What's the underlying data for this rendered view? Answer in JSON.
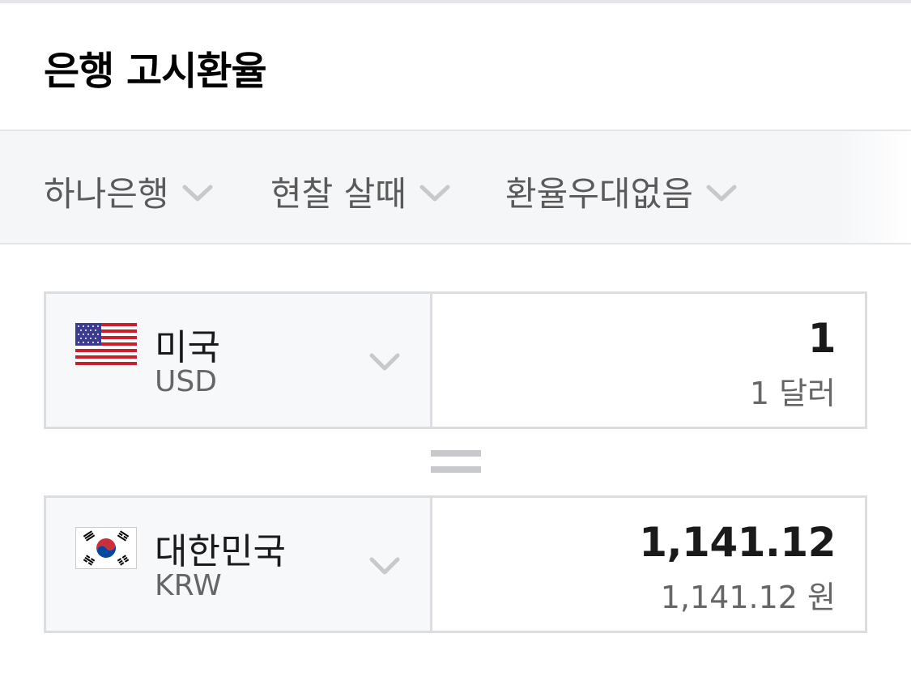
{
  "header": {
    "title": "은행 고시환율"
  },
  "filters": [
    {
      "label": "하나은행",
      "icon": "chevron-down-icon"
    },
    {
      "label": "현찰 살때",
      "icon": "chevron-down-icon"
    },
    {
      "label": "환율우대없음",
      "icon": "chevron-down-icon"
    }
  ],
  "from": {
    "country": "미국",
    "code": "USD",
    "flag_icon": "us-flag-icon",
    "amount": "1",
    "amount_text": "1 달러"
  },
  "equals_icon": "equals-icon",
  "to": {
    "country": "대한민국",
    "code": "KRW",
    "flag_icon": "kr-flag-icon",
    "amount": "1,141.12",
    "amount_text": "1,141.12 원"
  },
  "colors": {
    "background": "#ffffff",
    "filter_bar": "#f5f6f8",
    "border": "#dcdde0",
    "chevron": "#c8c9cc"
  }
}
